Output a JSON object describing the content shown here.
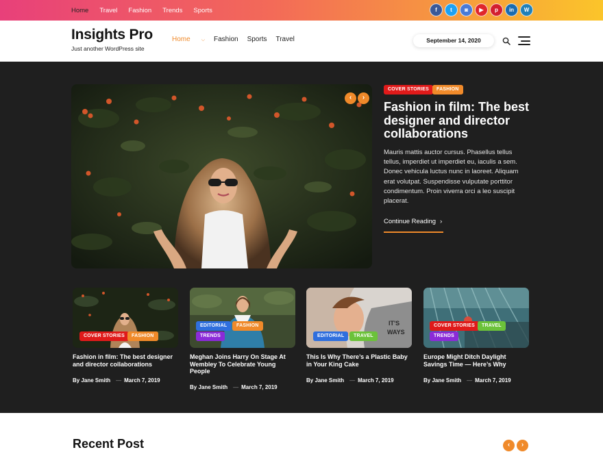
{
  "topbar": {
    "nav": [
      "Home",
      "Travel",
      "Fashion",
      "Trends",
      "Sports"
    ],
    "social_icons": [
      "facebook-icon",
      "twitter-icon",
      "instagram-icon",
      "youtube-icon",
      "pinterest-icon",
      "linkedin-icon",
      "wordpress-icon"
    ],
    "social_glyphs": [
      "f",
      "t",
      "◙",
      "▶",
      "p",
      "in",
      "W"
    ],
    "social_colors": [
      "#3b5998",
      "#1da1f2",
      "#4a7bd6",
      "#e0262b",
      "#d3202f",
      "#1b6bb0",
      "#2180b8"
    ]
  },
  "header": {
    "site_title": "Insights Pro",
    "tagline": "Just another WordPress site",
    "nav": [
      "Home",
      "Fashion",
      "Sports",
      "Travel"
    ],
    "date": "September 14, 2020"
  },
  "hero": {
    "tags": [
      "COVER STORIES",
      "FASHION"
    ],
    "title": "Fashion in film: The best designer and director collaborations",
    "excerpt": "Mauris mattis auctor cursus. Phasellus tellus tellus, imperdiet ut imperdiet eu, iaculis a sem. Donec vehicula luctus nunc in laoreet. Aliquam erat volutpat. Suspendisse vulputate porttitor condimentum. Proin viverra orci a leo suscipit placerat.",
    "cta": "Continue Reading",
    "prev": "‹",
    "next": "›"
  },
  "cards": [
    {
      "tags": [
        "COVER STORIES",
        "FASHION"
      ],
      "title": "Fashion in film: The best designer and director collaborations",
      "author": "By Jane Smith",
      "date": "March 7, 2019"
    },
    {
      "tags": [
        "EDITORIAL",
        "FASHION",
        "TRENDS"
      ],
      "title": "Meghan Joins Harry On Stage At Wembley To Celebrate Young People",
      "author": "By Jane Smith",
      "date": "March 7, 2019"
    },
    {
      "tags": [
        "EDITORIAL",
        "TRAVEL"
      ],
      "title": "This Is Why There’s a Plastic Baby in Your King Cake",
      "author": "By Jane Smith",
      "date": "March 7, 2019"
    },
    {
      "tags": [
        "COVER STORIES",
        "TRAVEL",
        "TRENDS"
      ],
      "title": "Europe Might Ditch Daylight Savings Time — Here’s Why",
      "author": "By Jane Smith",
      "date": "March 7, 2019"
    }
  ],
  "recent": {
    "heading": "Recent Post"
  },
  "colors": {
    "accent": "#f08a2a",
    "dark_bg": "#1f1f1f"
  }
}
